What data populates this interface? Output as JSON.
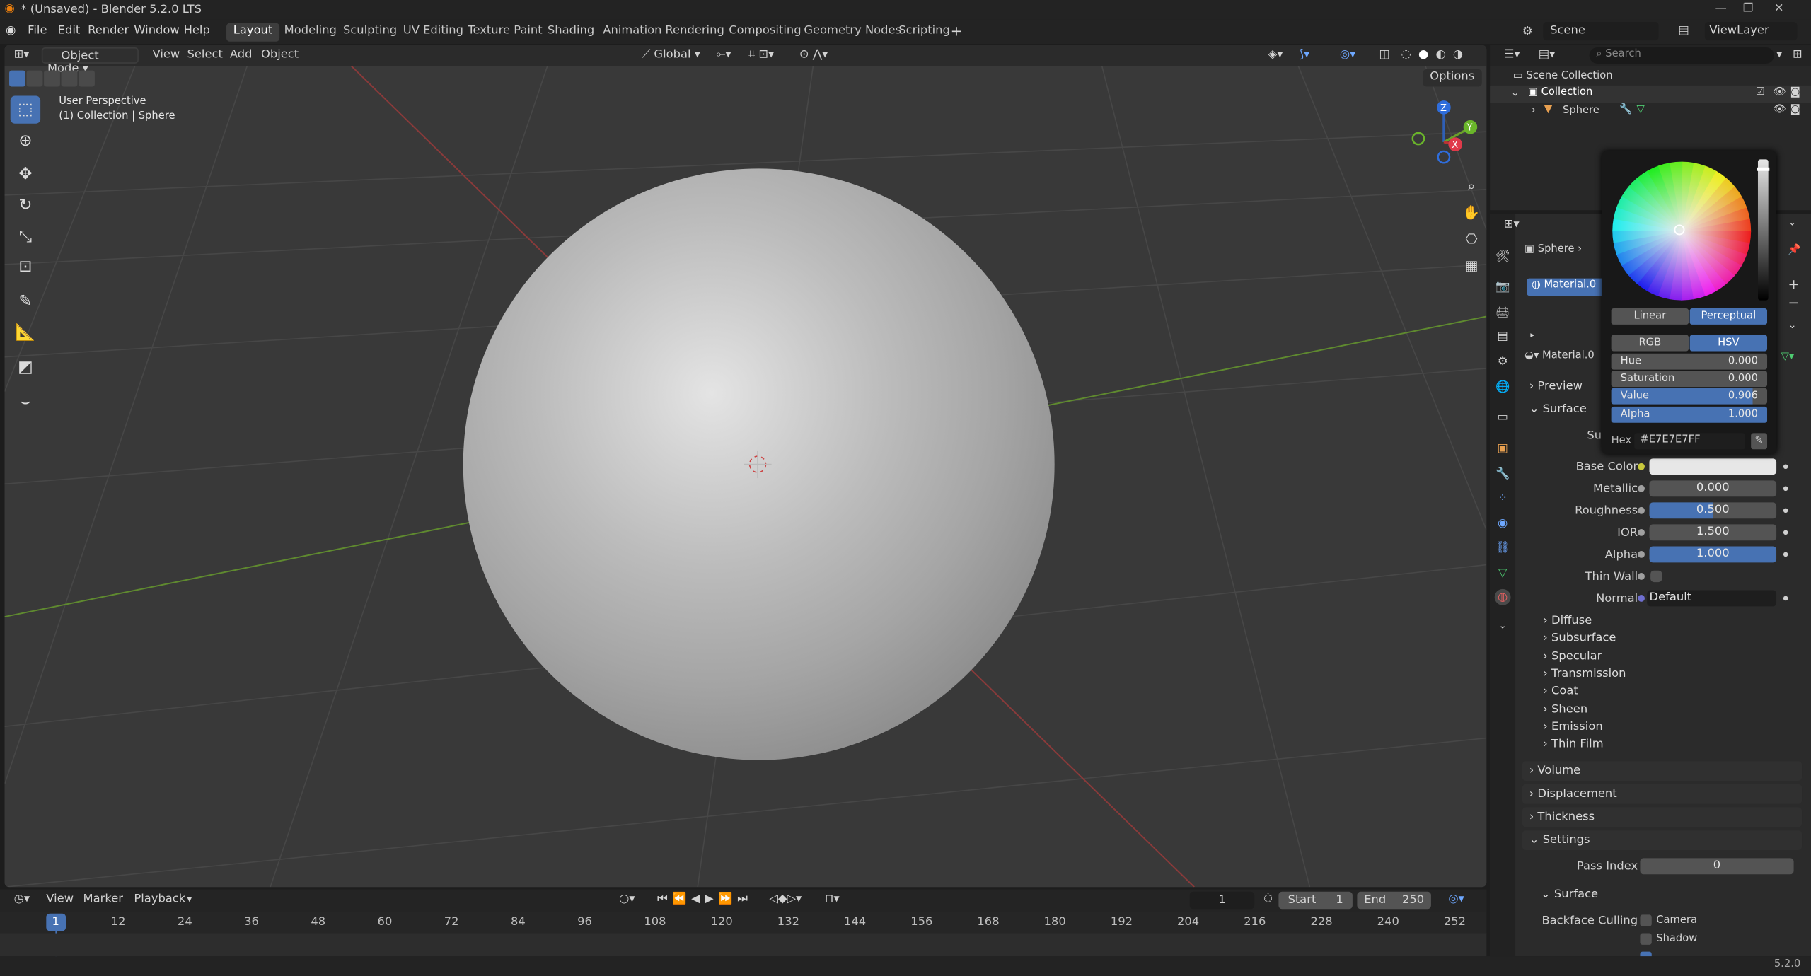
{
  "window": {
    "title": "* (Unsaved) - Blender 5.2.0 LTS"
  },
  "menu": [
    "File",
    "Edit",
    "Render",
    "Window",
    "Help"
  ],
  "workspaces": [
    "Layout",
    "Modeling",
    "Sculpting",
    "UV Editing",
    "Texture Paint",
    "Shading",
    "Animation",
    "Rendering",
    "Compositing",
    "Geometry Nodes",
    "Scripting"
  ],
  "scene_name": "Scene",
  "viewlayer_name": "ViewLayer",
  "viewport": {
    "mode": "Object Mode",
    "menus": [
      "View",
      "Select",
      "Add",
      "Object"
    ],
    "transform_orientation": "Global",
    "options_label": "Options",
    "overlay_line1": "User Perspective",
    "overlay_line2": "(1) Collection | Sphere",
    "gizmo": {
      "z": "Z",
      "y": "Y",
      "x": "X"
    }
  },
  "timeline": {
    "menus": [
      "View",
      "Marker",
      "Playback"
    ],
    "current_frame": "1",
    "start_label": "Start",
    "start": "1",
    "end_label": "End",
    "end": "250",
    "frame_numbers": [
      "1",
      "12",
      "24",
      "36",
      "48",
      "60",
      "72",
      "84",
      "96",
      "108",
      "120",
      "132",
      "144",
      "156",
      "168",
      "180",
      "192",
      "204",
      "216",
      "228",
      "240",
      "252"
    ]
  },
  "outliner": {
    "search_placeholder": "Search",
    "scene_collection": "Scene Collection",
    "collection": "Collection",
    "object": "Sphere"
  },
  "properties": {
    "object_name": "Sphere",
    "material_slot": "Material.0",
    "material_name": "Material.0",
    "panels": {
      "preview": "Preview",
      "surface": "Surface",
      "surface_short": "Su"
    },
    "fields": [
      {
        "label": "Base Color",
        "value": ""
      },
      {
        "label": "Metallic",
        "value": "0.000"
      },
      {
        "label": "Roughness",
        "value": "0.500"
      },
      {
        "label": "IOR",
        "value": "1.500"
      },
      {
        "label": "Alpha",
        "value": "1.000"
      },
      {
        "label": "Thin Wall",
        "value": ""
      },
      {
        "label": "Normal",
        "value": "Default"
      }
    ],
    "subpanels": [
      "Diffuse",
      "Subsurface",
      "Specular",
      "Transmission",
      "Coat",
      "Sheen",
      "Emission",
      "Thin Film"
    ],
    "lower_panels": [
      "Volume",
      "Displacement",
      "Thickness",
      "Settings"
    ],
    "pass_index_label": "Pass Index",
    "pass_index": "0",
    "settings_surface": "Surface",
    "backface_culling": "Backface Culling",
    "camera": "Camera",
    "shadow": "Shadow"
  },
  "picker": {
    "linear": "Linear",
    "perceptual": "Perceptual",
    "rgb": "RGB",
    "hsv": "HSV",
    "hue_label": "Hue",
    "hue": "0.000",
    "saturation_label": "Saturation",
    "saturation": "0.000",
    "value_label": "Value",
    "value": "0.906",
    "alpha_label": "Alpha",
    "alpha": "1.000",
    "hex_label": "Hex",
    "hex": "#E7E7E7FF"
  },
  "status": {
    "version": "5.2.0"
  },
  "colors": {
    "accent": "#4772b3",
    "base_color": "#e7e7e7"
  }
}
